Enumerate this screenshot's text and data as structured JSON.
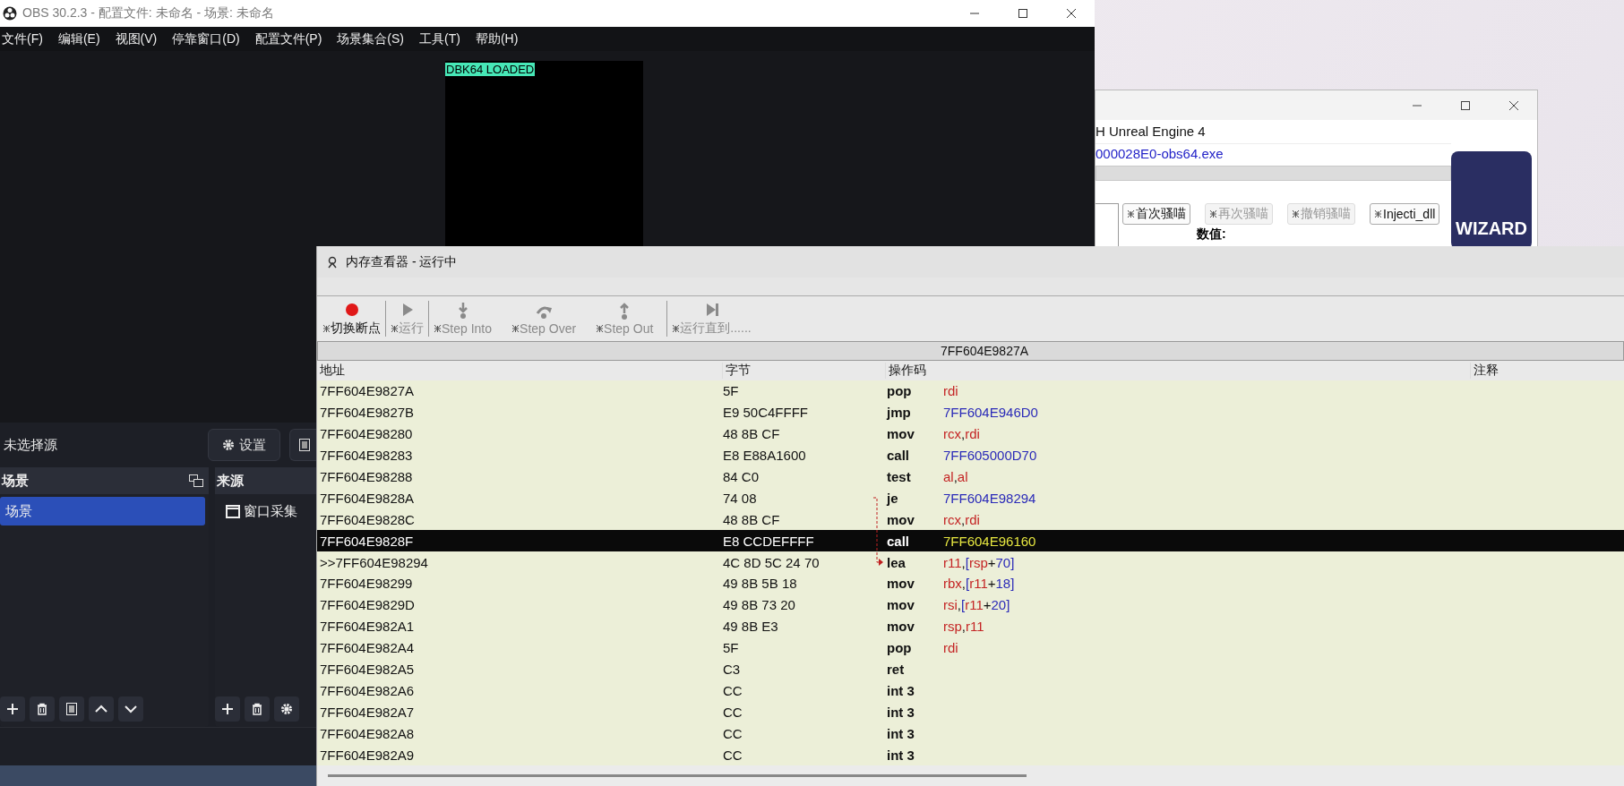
{
  "obs": {
    "title": "OBS 30.2.3 - 配置文件: 未命名 - 场景: 未命名",
    "menu": [
      "文件(F)",
      "编辑(E)",
      "视图(V)",
      "停靠窗口(D)",
      "配置文件(P)",
      "场景集合(S)",
      "工具(T)",
      "帮助(H)"
    ],
    "preview_label": "DBK64 LOADED",
    "source_status": "未选择源",
    "settings_button": "设置",
    "scenes": {
      "title": "场景",
      "items": [
        {
          "label": "场景",
          "selected": true
        }
      ]
    },
    "sources": {
      "title": "来源",
      "items": [
        {
          "label": "窗口采集",
          "selected": false
        }
      ]
    }
  },
  "cheat_engine": {
    "title": "H Unreal Engine 4",
    "process": "000028E0-obs64.exe",
    "progress": {
      "level": 0
    },
    "buttons": [
      {
        "label": "首次骚喵",
        "disabled": false
      },
      {
        "label": "再次骚喵",
        "disabled": true
      },
      {
        "label": "撤销骚喵",
        "disabled": true
      },
      {
        "label": "Injecti_dll",
        "disabled": false
      }
    ],
    "value_label": "数值:",
    "logo_text": "WIZARD"
  },
  "memory_viewer": {
    "title": "内存查看器 - 运行中",
    "toolbar": [
      {
        "kind": "breakpoint",
        "label": "切换断点",
        "disabled": false
      },
      {
        "kind": "run",
        "label": "运行",
        "disabled": true
      },
      {
        "kind": "step_into",
        "label": "Step Into",
        "disabled": true
      },
      {
        "kind": "step_over",
        "label": "Step Over",
        "disabled": true
      },
      {
        "kind": "step_out",
        "label": "Step Out",
        "disabled": true
      },
      {
        "kind": "run_to",
        "label": "运行直到......",
        "disabled": true
      }
    ],
    "address": "7FF604E9827A",
    "columns": [
      "地址",
      "字节",
      "操作码",
      "注释"
    ],
    "rows": [
      {
        "address": "7FF604E9827A",
        "bytes": "5F",
        "mnemonic": "pop",
        "operands": [
          {
            "kind": "reg",
            "text": "rdi"
          }
        ],
        "selected": false
      },
      {
        "address": "7FF604E9827B",
        "bytes": "E9 50C4FFFF",
        "mnemonic": "jmp",
        "operands": [
          {
            "kind": "num",
            "text": "7FF604E946D0"
          }
        ],
        "selected": false
      },
      {
        "address": "7FF604E98280",
        "bytes": "48 8B CF",
        "mnemonic": "mov",
        "operands": [
          {
            "kind": "reg",
            "text": "rcx"
          },
          {
            "kind": "sym",
            "text": ","
          },
          {
            "kind": "reg",
            "text": "rdi"
          }
        ],
        "selected": false
      },
      {
        "address": "7FF604E98283",
        "bytes": "E8 E88A1600",
        "mnemonic": "call",
        "operands": [
          {
            "kind": "num",
            "text": "7FF605000D70"
          }
        ],
        "selected": false
      },
      {
        "address": "7FF604E98288",
        "bytes": "84 C0",
        "mnemonic": "test",
        "operands": [
          {
            "kind": "reg",
            "text": "al"
          },
          {
            "kind": "sym",
            "text": ","
          },
          {
            "kind": "reg",
            "text": "al"
          }
        ],
        "selected": false
      },
      {
        "address": "7FF604E9828A",
        "bytes": "74 08",
        "mnemonic": "je",
        "operands": [
          {
            "kind": "num",
            "text": "7FF604E98294"
          }
        ],
        "selected": false,
        "jump_source": true
      },
      {
        "address": "7FF604E9828C",
        "bytes": "48 8B CF",
        "mnemonic": "mov",
        "operands": [
          {
            "kind": "reg",
            "text": "rcx"
          },
          {
            "kind": "sym",
            "text": ","
          },
          {
            "kind": "reg",
            "text": "rdi"
          }
        ],
        "selected": false
      },
      {
        "address": "7FF604E9828F",
        "bytes": "E8 CCDEFFFF",
        "mnemonic": "call",
        "operands": [
          {
            "kind": "num",
            "text": "7FF604E96160"
          }
        ],
        "selected": true
      },
      {
        "address": ">>7FF604E98294",
        "bytes": "4C 8D 5C 24 70",
        "mnemonic": "lea",
        "operands": [
          {
            "kind": "reg",
            "text": "r11"
          },
          {
            "kind": "sym",
            "text": ","
          },
          {
            "kind": "num",
            "text": "["
          },
          {
            "kind": "reg",
            "text": "rsp"
          },
          {
            "kind": "sym",
            "text": "+"
          },
          {
            "kind": "num",
            "text": "70"
          },
          {
            "kind": "num",
            "text": "]"
          }
        ],
        "selected": false,
        "jump_target": true
      },
      {
        "address": "7FF604E98299",
        "bytes": "49 8B 5B 18",
        "mnemonic": "mov",
        "operands": [
          {
            "kind": "reg",
            "text": "rbx"
          },
          {
            "kind": "sym",
            "text": ","
          },
          {
            "kind": "num",
            "text": "["
          },
          {
            "kind": "reg",
            "text": "r11"
          },
          {
            "kind": "sym",
            "text": "+"
          },
          {
            "kind": "num",
            "text": "18"
          },
          {
            "kind": "num",
            "text": "]"
          }
        ],
        "selected": false
      },
      {
        "address": "7FF604E9829D",
        "bytes": "49 8B 73 20",
        "mnemonic": "mov",
        "operands": [
          {
            "kind": "reg",
            "text": "rsi"
          },
          {
            "kind": "sym",
            "text": ","
          },
          {
            "kind": "num",
            "text": "["
          },
          {
            "kind": "reg",
            "text": "r11"
          },
          {
            "kind": "sym",
            "text": "+"
          },
          {
            "kind": "num",
            "text": "20"
          },
          {
            "kind": "num",
            "text": "]"
          }
        ],
        "selected": false
      },
      {
        "address": "7FF604E982A1",
        "bytes": "49 8B E3",
        "mnemonic": "mov",
        "operands": [
          {
            "kind": "reg",
            "text": "rsp"
          },
          {
            "kind": "sym",
            "text": ","
          },
          {
            "kind": "reg",
            "text": "r11"
          }
        ],
        "selected": false
      },
      {
        "address": "7FF604E982A4",
        "bytes": "5F",
        "mnemonic": "pop",
        "operands": [
          {
            "kind": "reg",
            "text": "rdi"
          }
        ],
        "selected": false
      },
      {
        "address": "7FF604E982A5",
        "bytes": "C3",
        "mnemonic": "ret",
        "operands": [],
        "selected": false
      },
      {
        "address": "7FF604E982A6",
        "bytes": "CC",
        "mnemonic": "int 3",
        "operands": [],
        "selected": false
      },
      {
        "address": "7FF604E982A7",
        "bytes": "CC",
        "mnemonic": "int 3",
        "operands": [],
        "selected": false
      },
      {
        "address": "7FF604E982A8",
        "bytes": "CC",
        "mnemonic": "int 3",
        "operands": [],
        "selected": false
      },
      {
        "address": "7FF604E982A9",
        "bytes": "CC",
        "mnemonic": "int 3",
        "operands": [],
        "selected": false
      }
    ]
  }
}
